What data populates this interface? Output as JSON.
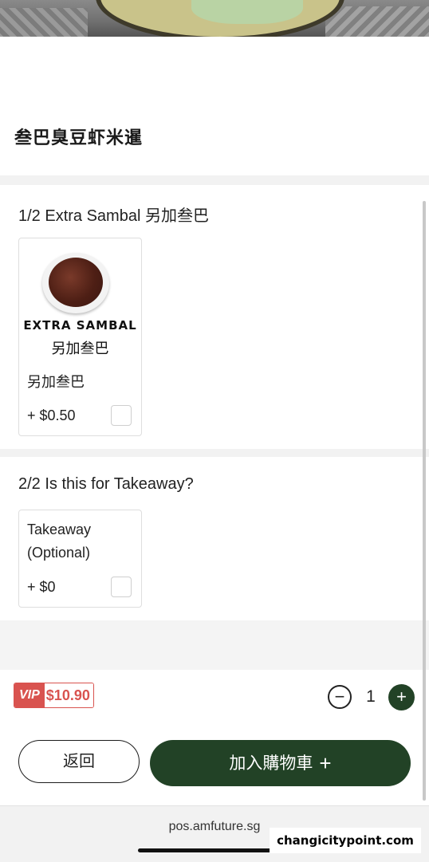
{
  "dish": {
    "title": "叁巴臭豆虾米暹"
  },
  "groups": [
    {
      "title": "1/2 Extra Sambal 另加叁巴",
      "options": [
        {
          "image_text_en": "EXTRA SAMBAL",
          "image_text_cn": "另加叁巴",
          "name": "另加叁巴",
          "price": "+ $0.50"
        }
      ]
    },
    {
      "title": "2/2 Is this for Takeaway?",
      "options": [
        {
          "name_line1": "Takeaway",
          "name_line2": "(Optional)",
          "price": "+ $0"
        }
      ]
    }
  ],
  "footer_bar": {
    "vip_label": "VIP",
    "vip_price": "$10.90",
    "quantity": "1",
    "minus_symbol": "−",
    "plus_symbol": "+"
  },
  "actions": {
    "back_label": "返回",
    "add_to_cart_label": "加入購物車",
    "add_to_cart_icon": "+"
  },
  "browser": {
    "url": "pos.amfuture.sg"
  },
  "watermark": "changicitypoint.com",
  "colors": {
    "brand_green": "#224226",
    "vip_red": "#d9534f"
  }
}
